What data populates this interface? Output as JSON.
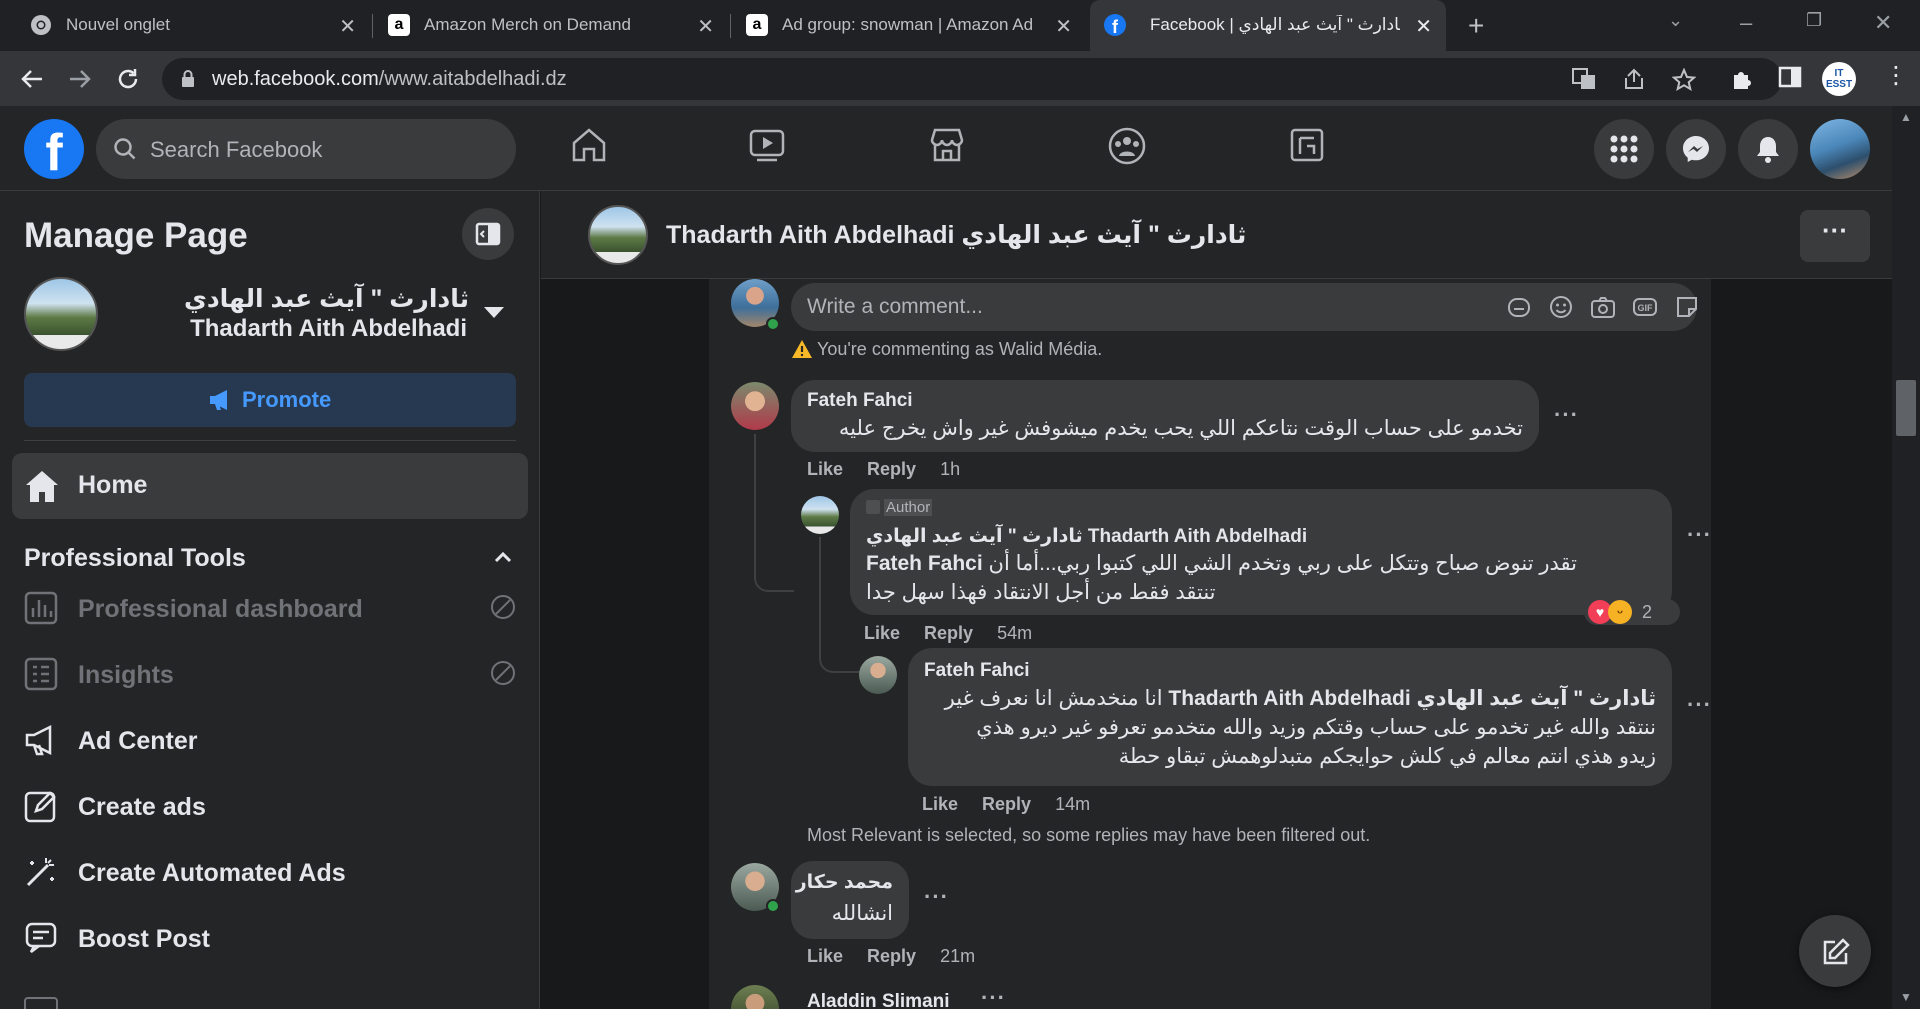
{
  "browser": {
    "tabs": [
      {
        "title": "Nouvel onglet",
        "icon": "chrome-icon"
      },
      {
        "title": "Amazon Merch on Demand",
        "icon": "amazon-icon"
      },
      {
        "title": "Ad group: snowman | Amazon Ad",
        "icon": "amazon-icon"
      },
      {
        "title": "Facebook | ثادارث \" آيث عبد الهادي",
        "icon": "facebook-icon"
      }
    ],
    "url_domain": "web.facebook.com",
    "url_path": "/www.aitabdelhadi.dz",
    "profile_label": "IT ESST"
  },
  "fb": {
    "search_placeholder": "Search Facebook",
    "brand_color": "#1877f2"
  },
  "sidebar": {
    "title": "Manage Page",
    "page_name_ar": "ثادارث \" آيث عبد الهادي",
    "page_name_en": "Thadarth Aith Abdelhadi",
    "promote_label": "Promote",
    "home_label": "Home",
    "section_title": "Professional Tools",
    "items": [
      {
        "label": "Professional dashboard",
        "icon": "dashboard-icon",
        "disabled": true
      },
      {
        "label": "Insights",
        "icon": "insights-icon",
        "disabled": true
      },
      {
        "label": "Ad Center",
        "icon": "megaphone-icon"
      },
      {
        "label": "Create ads",
        "icon": "pencil-square-icon"
      },
      {
        "label": "Create Automated Ads",
        "icon": "magic-wand-icon"
      },
      {
        "label": "Boost Post",
        "icon": "boost-post-icon"
      }
    ]
  },
  "pagebar": {
    "name": "Thadarth Aith Abdelhadi ثادارث \" آيث عبد الهادي",
    "more_label": "···"
  },
  "comments": {
    "write_placeholder": "Write a comment...",
    "commenting_as": "You're commenting as Walid Média.",
    "c1": {
      "name": "Fateh Fahci",
      "text": "تخدمو على حساب الوقت نتاعكم اللي يحب يخدم ميشوفش غير واش يخرج عليه",
      "like": "Like",
      "reply": "Reply",
      "time": "1h"
    },
    "c2": {
      "author_badge": "Author",
      "name": "ثادارث \" آيث عبد الهادي Thadarth Aith Abdelhadi",
      "line1_mention": "Fateh Fahci",
      "line1": "تقدر تنوض صباح وتتكل على ربي وتخدم الشي اللي كتبوا ربي...أما أن",
      "line2": "تنتقد فقط من أجل الانتقاد فهذا سهل جدا",
      "like": "Like",
      "reply": "Reply",
      "time": "54m",
      "reaction_count": "2"
    },
    "c3": {
      "name": "Fateh Fahci",
      "line1_mention": "ثادارث \" آيث عبد الهادي Thadarth Aith Abdelhadi",
      "line1": "انا منخدمش انا نعرف غير",
      "line2": "ننتقد والله غير تخدمو على حساب وقتكم وزيد والله متخدمو تعرفو غير ديرو هذي",
      "line3": "زيدو هذي انتم معالم في كلش حوايجكم متبدلوهمش تبقاو حطة",
      "like": "Like",
      "reply": "Reply",
      "time": "14m"
    },
    "filtered_note": "Most Relevant is selected, so some replies may have been filtered out.",
    "c4": {
      "name": "محمد حكار",
      "text": "انشالله",
      "like": "Like",
      "reply": "Reply",
      "time": "21m"
    },
    "c5": {
      "name": "Aladdin Slimani"
    }
  }
}
